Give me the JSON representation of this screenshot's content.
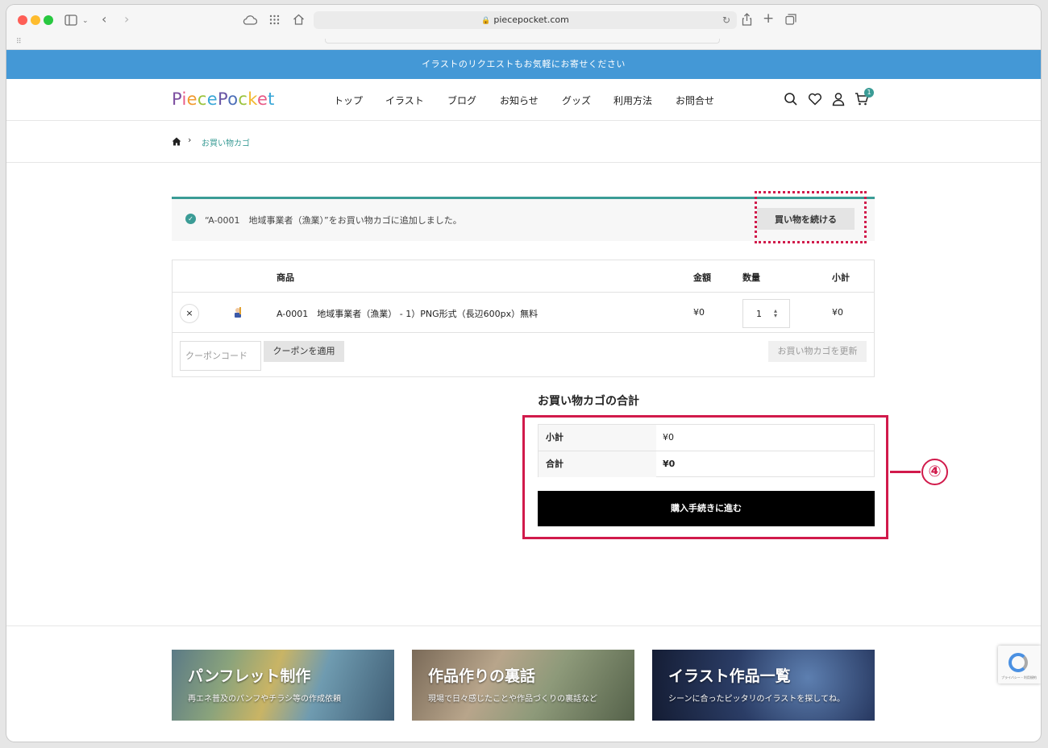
{
  "browser": {
    "url": "piecepocket.com"
  },
  "site": {
    "banner_text": "イラストのリクエストもお気軽にお寄せください",
    "logo_text": [
      "P",
      "i",
      "e",
      "c",
      "e",
      "P",
      "o",
      "c",
      "k",
      "e",
      "t"
    ],
    "nav": [
      "トップ",
      "イラスト",
      "ブログ",
      "お知らせ",
      "グッズ",
      "利用方法",
      "お問合せ"
    ],
    "cart_count": "1",
    "accent_color": "#3b9c96",
    "banner_color": "#4498d6"
  },
  "breadcrumb": {
    "current": "お買い物カゴ"
  },
  "notice": {
    "message": "“A-0001　地域事業者（漁業）”をお買い物カゴに追加しました。",
    "continue_button": "買い物を続ける"
  },
  "cart": {
    "headers": {
      "product": "商品",
      "price": "金額",
      "quantity": "数量",
      "subtotal": "小計"
    },
    "items": [
      {
        "name": "A-0001　地域事業者（漁業） - 1）PNG形式（長辺600px）無料",
        "price": "¥0",
        "quantity": "1",
        "subtotal": "¥0"
      }
    ],
    "remove_symbol": "×",
    "coupon_placeholder": "クーポンコード",
    "coupon_button": "クーポンを適用",
    "update_button": "お買い物カゴを更新"
  },
  "totals": {
    "title": "お買い物カゴの合計",
    "subtotal_label": "小計",
    "subtotal_value": "¥0",
    "total_label": "合計",
    "total_value": "¥0",
    "checkout_button": "購入手続きに進む"
  },
  "annotation": {
    "callout_number": "④",
    "highlight_color": "#d11a4b"
  },
  "promos": [
    {
      "title": "パンフレット制作",
      "subtitle": "再エネ普及のパンフやチラシ等の作成依頼"
    },
    {
      "title": "作品作りの裏話",
      "subtitle": "現場で日々感じたことや作品づくりの裏話など"
    },
    {
      "title": "イラスト作品一覧",
      "subtitle": "シーンに合ったピッタリのイラストを探してね。"
    }
  ],
  "recaptcha": {
    "text": "プライバシー・利用規約"
  }
}
